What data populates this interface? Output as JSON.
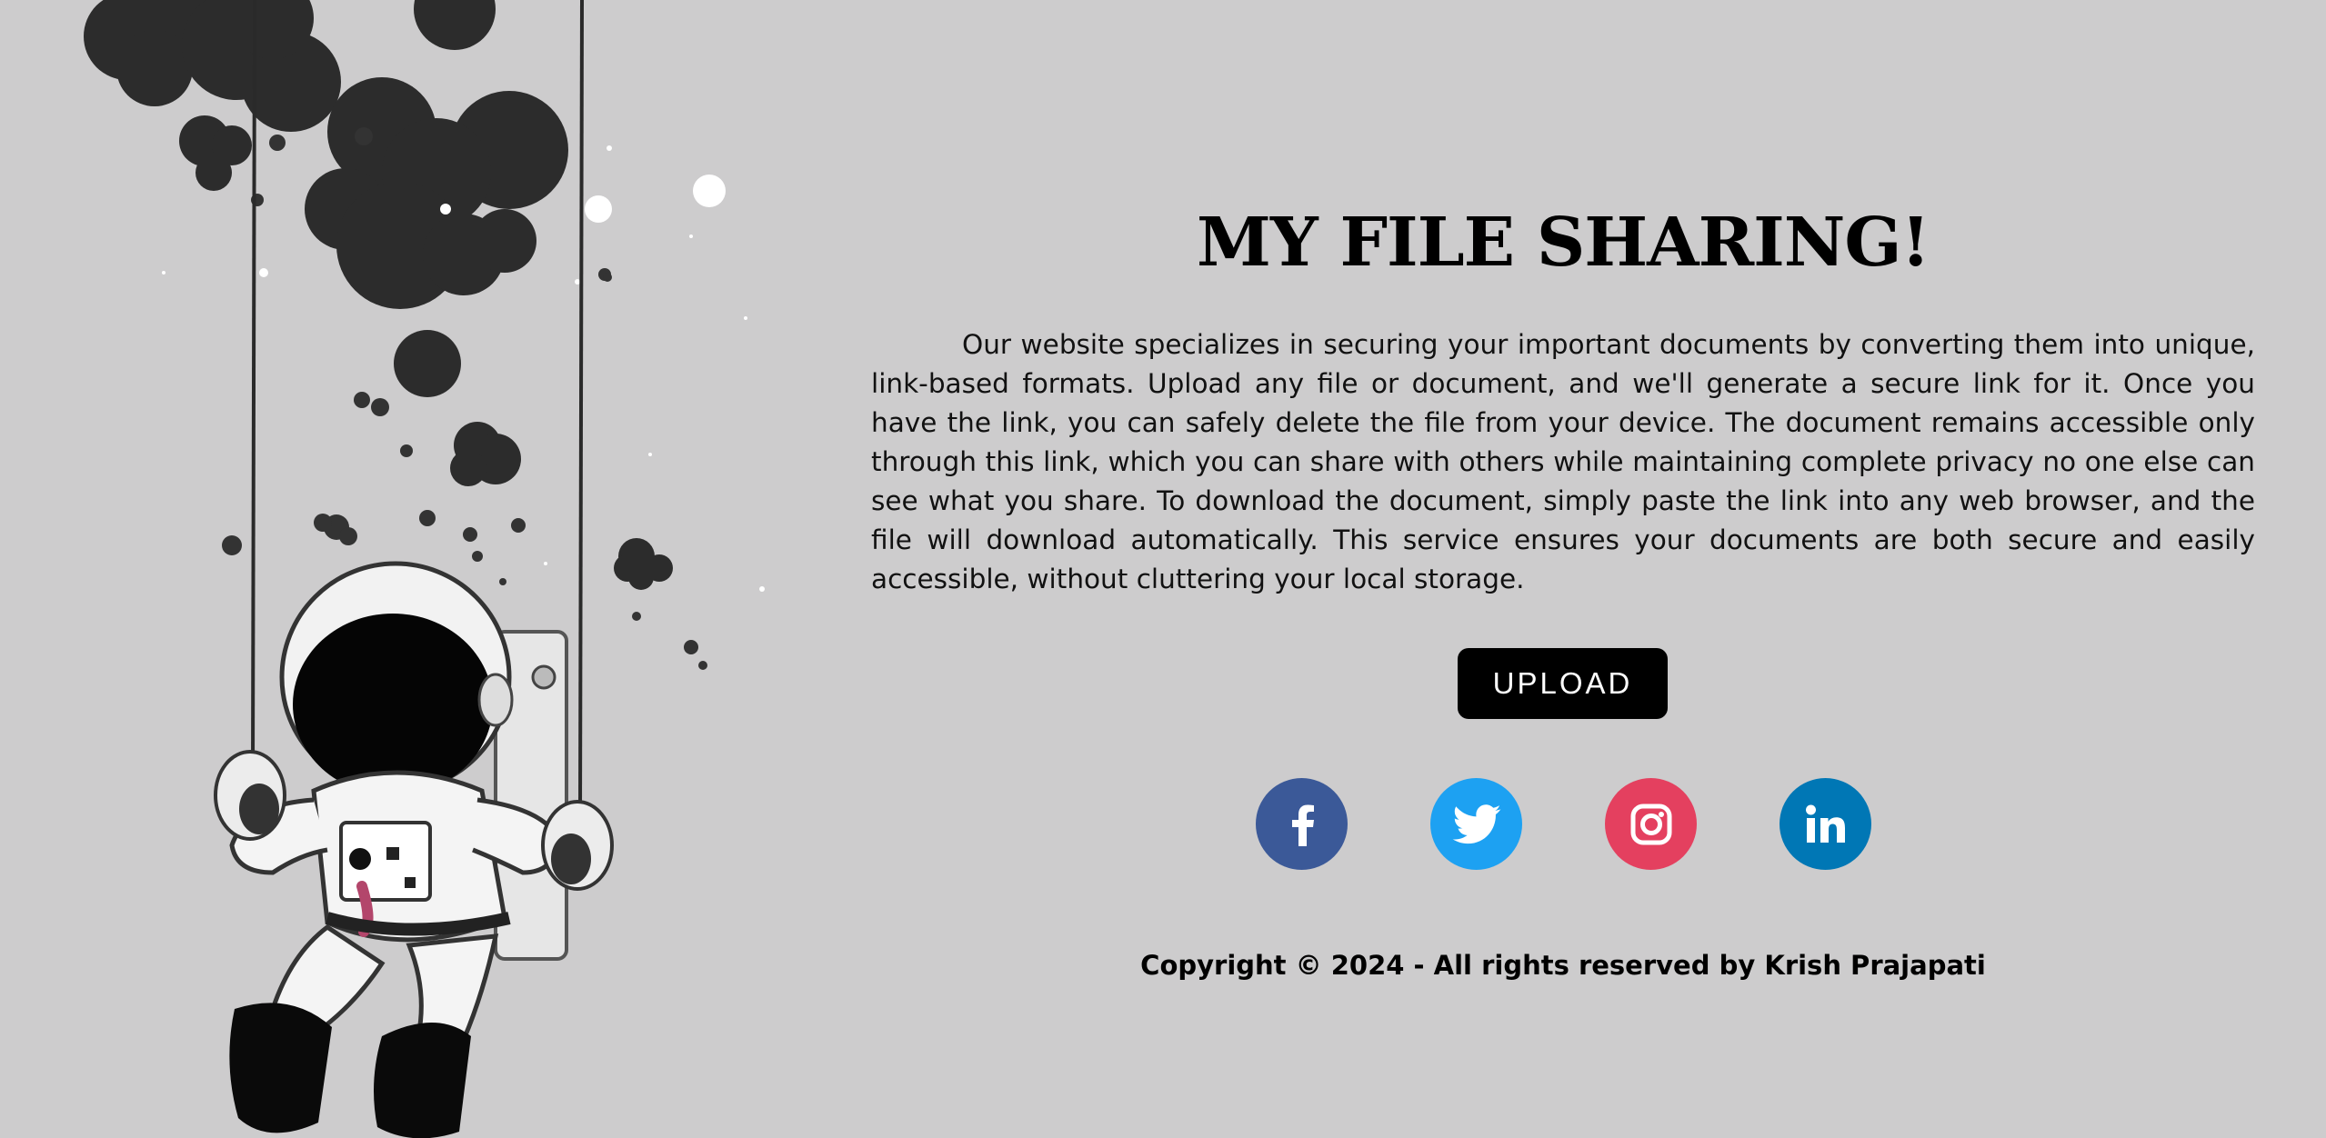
{
  "page": {
    "title": "MY FILE SHARING!",
    "description": "Our website specializes in securing your important documents by converting them into unique, link-based formats. Upload any file or document, and we'll generate a secure link for it. Once you have the link, you can safely delete the file from your device. The document remains accessible only through this link, which you can share with others while maintaining complete privacy no one else can see what you share. To download the document, simply paste the link into any web browser, and the file will download automatically. This service ensures your documents are both secure and easily accessible, without cluttering your local storage.",
    "upload_label": "UPLOAD",
    "footer": "Copyright © 2024 - All rights reserved by Krish Prajapati"
  },
  "social": [
    {
      "icon": "facebook-icon",
      "color": "#3b5998"
    },
    {
      "icon": "twitter-icon",
      "color": "#1da1f2"
    },
    {
      "icon": "instagram-icon",
      "color": "#e4405f"
    },
    {
      "icon": "linkedin-icon",
      "color": "#0077b5"
    }
  ],
  "colors": {
    "background": "#cdcccd",
    "button": "#000000"
  }
}
